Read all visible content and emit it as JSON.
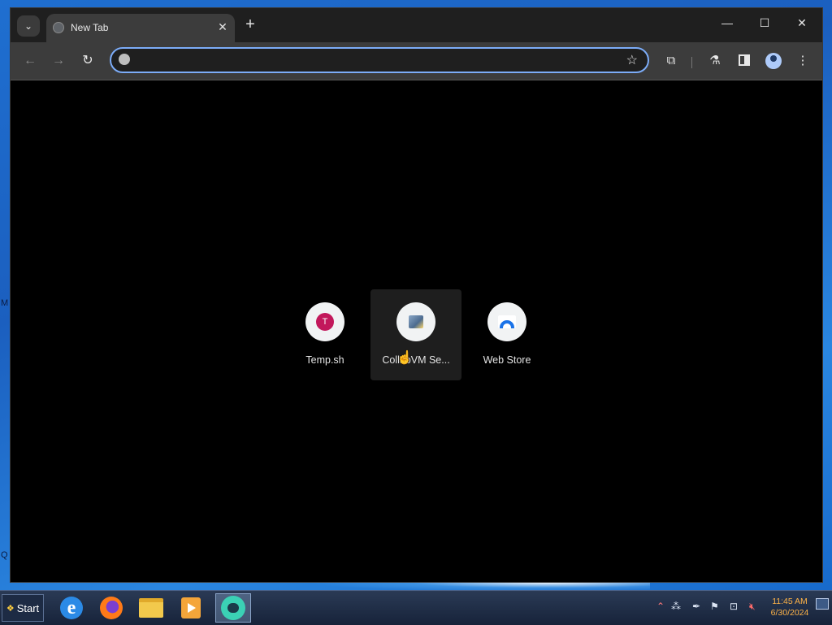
{
  "desktop": {
    "edge_labels": [
      "M",
      "Q"
    ]
  },
  "browser": {
    "tab": {
      "title": "New Tab"
    },
    "tab_search_icon": "chevron-down-icon",
    "new_tab_symbol": "+",
    "window_controls": {
      "minimize": "—",
      "maximize": "☐",
      "close": "✕"
    },
    "toolbar": {
      "back": "←",
      "forward": "→",
      "reload": "↻",
      "omnibox": {
        "value": "",
        "placeholder": ""
      },
      "star": "☆",
      "extensions": "⧉",
      "labs": "⚗",
      "menu": "⋮"
    },
    "shortcuts": [
      {
        "label": "Temp.sh",
        "badge": "T",
        "icon": "temp-sh-icon"
      },
      {
        "label": "CollabVM Se...",
        "icon": "collabvm-icon"
      },
      {
        "label": "Web Store",
        "icon": "web-store-icon"
      }
    ]
  },
  "taskbar": {
    "start_label": "Start",
    "apps": [
      "internet-explorer",
      "firefox",
      "file-explorer",
      "media-player",
      "chat-app"
    ],
    "clock": {
      "time": "11:45 AM",
      "date": "6/30/2024"
    }
  }
}
